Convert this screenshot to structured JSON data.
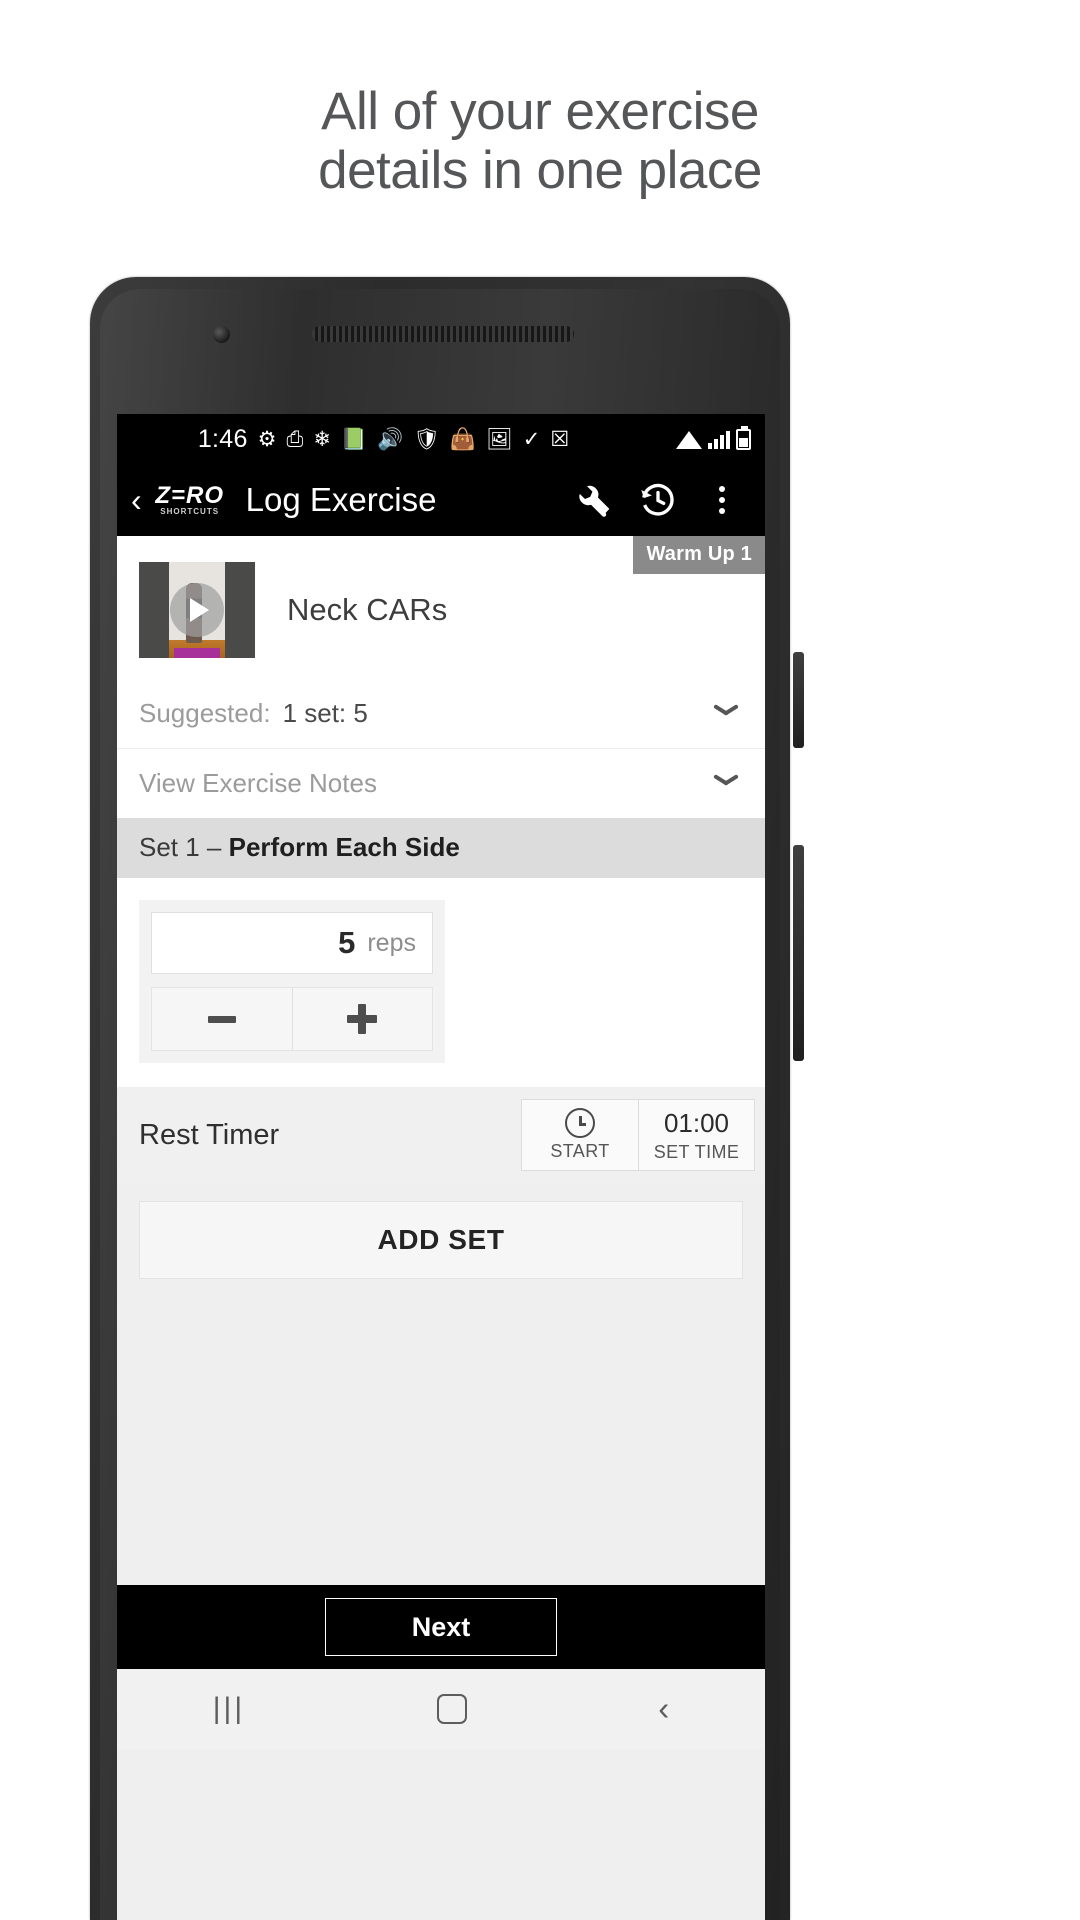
{
  "headline": {
    "line1": "All of your exercise",
    "line2": "details in one place"
  },
  "statusbar": {
    "time": "1:46",
    "icons": [
      "gear-icon",
      "search-doc-icon",
      "snowflake-icon",
      "book-icon",
      "speaker-icon",
      "shield-icon",
      "bag-icon",
      "photo-icon",
      "check-tag-icon",
      "x-box-icon"
    ],
    "right_icons": [
      "wifi-icon",
      "signal-icon",
      "battery-icon"
    ]
  },
  "appbar": {
    "back_label": "‹",
    "brand_top": "Z=RO",
    "brand_bottom": "SHORTCUTS",
    "title": "Log Exercise",
    "actions": [
      "wrench-icon",
      "history-icon",
      "overflow-menu-icon"
    ]
  },
  "exercise": {
    "badge": "Warm Up 1",
    "name": "Neck CARs",
    "suggested_label": "Suggested:",
    "suggested_value": "1 set: 5",
    "notes_label": "View Exercise Notes"
  },
  "set": {
    "header_prefix": "Set 1 – ",
    "header_bold": "Perform Each Side",
    "reps_value": "5",
    "reps_unit": "reps",
    "minus_label": "−",
    "plus_label": "+"
  },
  "rest": {
    "label": "Rest Timer",
    "start_label": "START",
    "time_value": "01:00",
    "time_sub": "SET TIME"
  },
  "actions": {
    "add_set": "ADD SET",
    "next": "Next"
  },
  "navbar": {
    "recent": "|||",
    "home": "home-icon",
    "back": "‹"
  },
  "colors": {
    "appbar_bg": "#000000",
    "badge_bg": "#8a8a8a",
    "set_header_bg": "#dcdcdc",
    "screen_bg": "#efefef",
    "headline_text": "#555658"
  }
}
